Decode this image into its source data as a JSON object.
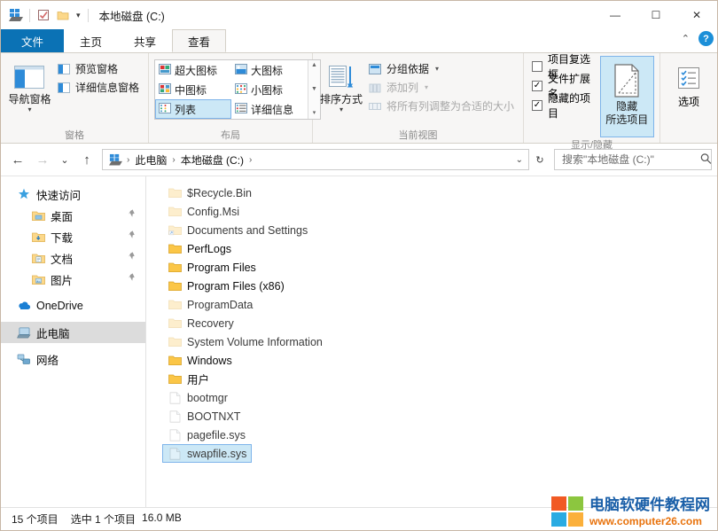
{
  "window": {
    "title": "本地磁盘 (C:)",
    "quick_access_icons": [
      "explorer-icon",
      "properties-icon",
      "new-folder-icon"
    ],
    "qat_dropdown": "▾",
    "controls": {
      "minimize": "—",
      "maximize": "☐",
      "close": "✕"
    }
  },
  "tabs": {
    "file": "文件",
    "items": [
      {
        "label": "主页",
        "active": false
      },
      {
        "label": "共享",
        "active": false
      },
      {
        "label": "查看",
        "active": true
      }
    ],
    "collapse_ribbon": "⌃",
    "help": "?"
  },
  "ribbon": {
    "groups": [
      {
        "label": "窗格",
        "big_button": {
          "label": "导航窗格",
          "icon": "navigation-pane-icon",
          "dropdown": "▾"
        },
        "small_items": [
          {
            "label": "预览窗格",
            "icon": "preview-pane-icon",
            "disabled": false
          },
          {
            "label": "详细信息窗格",
            "icon": "details-pane-icon",
            "disabled": false
          }
        ]
      },
      {
        "label": "布局",
        "gallery": [
          {
            "label": "超大图标",
            "icon": "extra-large-icons-icon",
            "selected": false
          },
          {
            "label": "大图标",
            "icon": "large-icons-icon",
            "selected": false
          },
          {
            "label": "中图标",
            "icon": "medium-icons-icon",
            "selected": false
          },
          {
            "label": "小图标",
            "icon": "small-icons-icon",
            "selected": false
          },
          {
            "label": "列表",
            "icon": "list-view-icon",
            "selected": true
          },
          {
            "label": "详细信息",
            "icon": "details-view-icon",
            "selected": false
          }
        ],
        "scroll_up": "▲",
        "scroll_down": "▼",
        "scroll_more": "▾"
      },
      {
        "label": "当前视图",
        "big_button": {
          "label": "排序方式",
          "icon": "sort-by-icon",
          "dropdown": "▾"
        },
        "small_items": [
          {
            "label": "分组依据",
            "icon": "group-by-icon",
            "disabled": false,
            "caret": "▾"
          },
          {
            "label": "添加列",
            "icon": "add-columns-icon",
            "disabled": true,
            "caret": "▾"
          },
          {
            "label": "将所有列调整为合适的大小",
            "icon": "size-columns-icon",
            "disabled": true,
            "caret": ""
          }
        ]
      },
      {
        "label": "显示/隐藏",
        "checkboxes": [
          {
            "label": "项目复选框",
            "checked": false
          },
          {
            "label": "文件扩展名",
            "checked": true
          },
          {
            "label": "隐藏的项目",
            "checked": true
          }
        ],
        "hide_button": {
          "line1": "隐藏",
          "line2": "所选项目",
          "icon": "hide-selected-items-icon",
          "selected": true
        },
        "options_button": {
          "label": "选项",
          "icon": "options-icon"
        }
      }
    ]
  },
  "address": {
    "back": "←",
    "forward": "→",
    "history": "⌄",
    "up": "↑",
    "breadcrumbs": [
      "此电脑",
      "本地磁盘 (C:)"
    ],
    "root_icon": "this-pc-icon",
    "separator": "›",
    "dropdown": "⌄",
    "refresh": "↻",
    "search_placeholder": "搜索\"本地磁盘 (C:)\"",
    "search_value": "",
    "search_icon": "search-icon"
  },
  "nav_pane": {
    "items": [
      {
        "label": "快速访问",
        "icon": "star-icon",
        "indent": false,
        "pinned": false,
        "selected": false
      },
      {
        "label": "桌面",
        "icon": "desktop-folder-icon",
        "indent": true,
        "pinned": true,
        "selected": false
      },
      {
        "label": "下载",
        "icon": "downloads-folder-icon",
        "indent": true,
        "pinned": true,
        "selected": false
      },
      {
        "label": "文档",
        "icon": "documents-folder-icon",
        "indent": true,
        "pinned": true,
        "selected": false
      },
      {
        "label": "图片",
        "icon": "pictures-folder-icon",
        "indent": true,
        "pinned": true,
        "selected": false
      },
      {
        "label": "OneDrive",
        "icon": "onedrive-cloud-icon",
        "indent": false,
        "pinned": false,
        "selected": false
      },
      {
        "label": "此电脑",
        "icon": "this-pc-icon",
        "indent": false,
        "pinned": false,
        "selected": true
      },
      {
        "label": "网络",
        "icon": "network-icon",
        "indent": false,
        "pinned": false,
        "selected": false
      }
    ],
    "pin_glyph": "📌"
  },
  "files": [
    {
      "name": "$Recycle.Bin",
      "type": "folder",
      "hidden": true,
      "selected": false
    },
    {
      "name": "Config.Msi",
      "type": "folder",
      "hidden": true,
      "selected": false
    },
    {
      "name": "Documents and Settings",
      "type": "junction",
      "hidden": true,
      "selected": false
    },
    {
      "name": "PerfLogs",
      "type": "folder",
      "hidden": false,
      "selected": false
    },
    {
      "name": "Program Files",
      "type": "folder",
      "hidden": false,
      "selected": false
    },
    {
      "name": "Program Files (x86)",
      "type": "folder",
      "hidden": false,
      "selected": false
    },
    {
      "name": "ProgramData",
      "type": "folder",
      "hidden": true,
      "selected": false
    },
    {
      "name": "Recovery",
      "type": "folder",
      "hidden": true,
      "selected": false
    },
    {
      "name": "System Volume Information",
      "type": "folder",
      "hidden": true,
      "selected": false
    },
    {
      "name": "Windows",
      "type": "folder",
      "hidden": false,
      "selected": false
    },
    {
      "name": "用户",
      "type": "folder",
      "hidden": false,
      "selected": false
    },
    {
      "name": "bootmgr",
      "type": "file",
      "hidden": true,
      "selected": false
    },
    {
      "name": "BOOTNXT",
      "type": "file",
      "hidden": true,
      "selected": false
    },
    {
      "name": "pagefile.sys",
      "type": "file",
      "hidden": true,
      "selected": false
    },
    {
      "name": "swapfile.sys",
      "type": "file",
      "hidden": true,
      "selected": true
    }
  ],
  "status": {
    "item_count": "15 个项目",
    "selection": "选中 1 个项目",
    "size": "16.0 MB"
  },
  "watermark": {
    "title": "电脑软硬件教程网",
    "url": "www.computer26.com",
    "logo_colors": [
      "#f15a24",
      "#8cc63f",
      "#29abe2",
      "#fbb03b"
    ]
  },
  "colors": {
    "accent_blue": "#0b72b5",
    "selection_blue": "#cce8f6",
    "selection_border": "#7eb4ea",
    "ribbon_bg": "#f7f6f5",
    "folder_yellow": "#ffd279"
  }
}
